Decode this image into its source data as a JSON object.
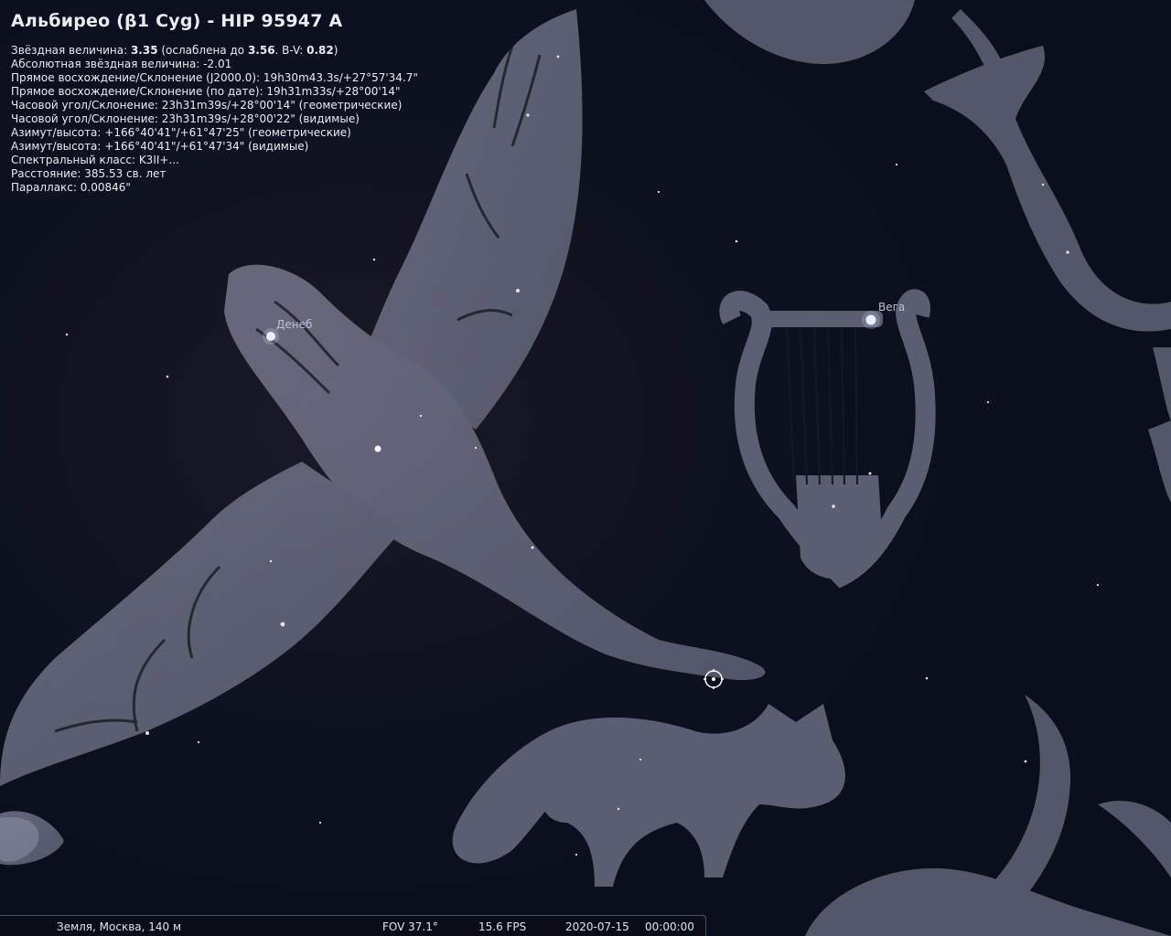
{
  "object_info": {
    "title": "Альбирео (β1 Cyg) - HIP 95947 A",
    "magnitude": {
      "label": "Звёздная величина: ",
      "value": "3.35",
      "extinction_label": " (ослаблена до ",
      "extinction_value": "3.56",
      "bv_label": ". B-V: ",
      "bv_value": "0.82",
      "close": ")"
    },
    "lines": [
      "Абсолютная звёздная величина: -2.01",
      "Прямое восхождение/Склонение (J2000.0): 19h30m43.3s/+27°57'34.7\"",
      "Прямое восхождение/Склонение (по дате): 19h31m33s/+28°00'14\"",
      "Часовой угол/Склонение: 23h31m39s/+28°00'14\" (геометрические)",
      "Часовой угол/Склонение: 23h31m39s/+28°00'22\" (видимые)",
      "Азимут/высота: +166°40'41\"/+61°47'25\" (геометрические)",
      "Азимут/высота: +166°40'41\"/+61°47'34\" (видимые)",
      "Спектральный класс: K3II+...",
      "Расстояние: 385.53 св. лет",
      "Параллакс: 0.00846\""
    ]
  },
  "star_labels": {
    "deneb": "Денеб",
    "vega": "Вега"
  },
  "status_bar": {
    "location": "Земля, Москва, 140 м",
    "fov": "FOV 37.1°",
    "fps": "15.6 FPS",
    "date": "2020-07-15",
    "time": "00:00:00"
  },
  "colors": {
    "sky": "#0b0f1d",
    "artwork": "#8f93a6",
    "selection_marker": "#ffffff",
    "text": "#e9ecf2"
  }
}
